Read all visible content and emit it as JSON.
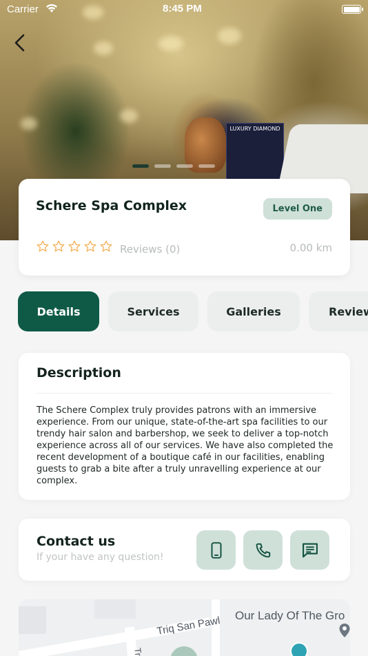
{
  "status_bar": {
    "carrier": "Carrier",
    "time": "8:45 PM"
  },
  "hero": {
    "box_text": "LUXURY DIAMOND",
    "slides": 4,
    "active_slide": 1
  },
  "venue": {
    "name": "Schere Spa Complex",
    "level": "Level One",
    "rating": 0,
    "rating_max": 5,
    "reviews": "Reviews (0)",
    "distance": "0.00 km"
  },
  "tabs": [
    {
      "label": "Details",
      "active": true
    },
    {
      "label": "Services",
      "active": false
    },
    {
      "label": "Galleries",
      "active": false
    },
    {
      "label": "Reviews",
      "active": false
    }
  ],
  "description": {
    "title": "Description",
    "text": "The Schere Complex truly provides patrons with an immersive experience. From our unique, state-of-the-art spa facilities to our trendy hair salon and barbershop, we seek to deliver a top-notch experience across all of our services. We have also completed the recent development of a boutique café in our facilities, enabling guests to grab a bite after a truly unravelling experience at our complex."
  },
  "contact": {
    "title": "Contact us",
    "subtitle": "If your have any question!",
    "buttons": [
      "mobile-icon",
      "phone-icon",
      "chat-icon"
    ]
  },
  "map": {
    "labels": [
      "Triq San Pawl",
      "Our Lady Of The Gro",
      "Tri"
    ]
  },
  "colors": {
    "primary": "#0f5a46",
    "badge_bg": "#cfe0d9",
    "star": "#f3b25b",
    "muted": "#b7bcb9"
  }
}
